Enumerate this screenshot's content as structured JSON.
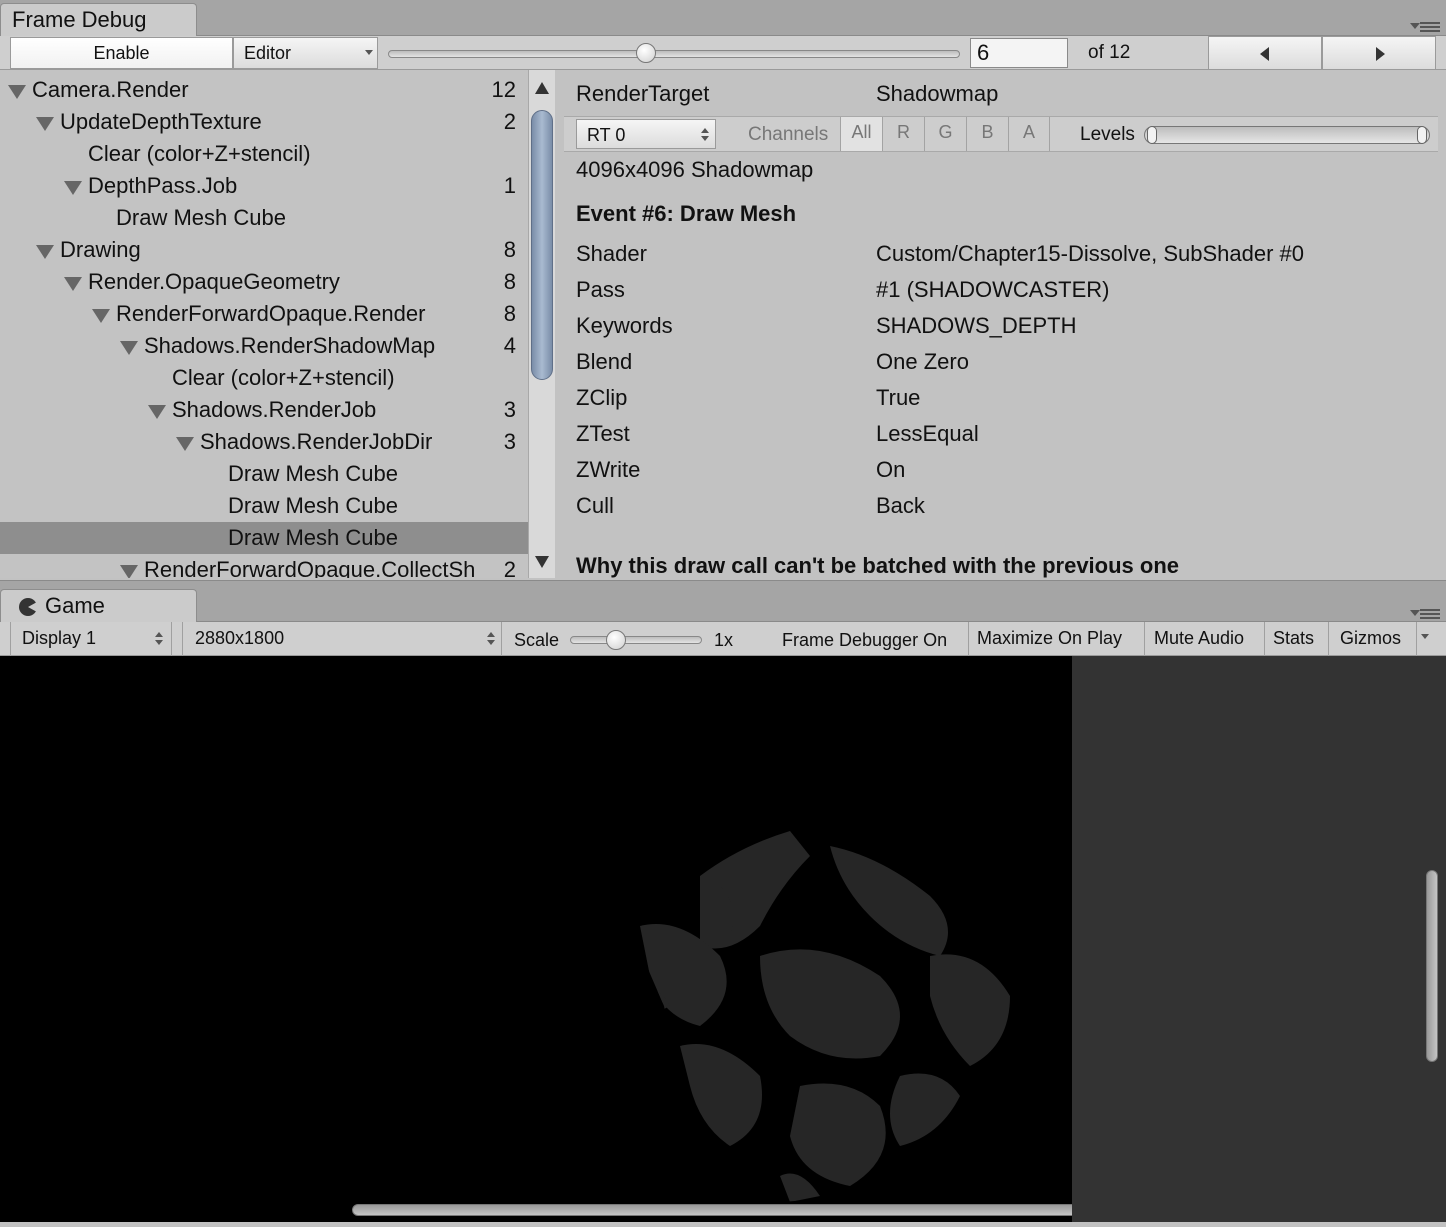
{
  "frame_debug": {
    "tab_title": "Frame Debug",
    "enable_label": "Enable",
    "editor_label": "Editor",
    "event_index": "6",
    "event_total": "of 12",
    "slider_fraction": 0.45,
    "tree": [
      {
        "label": "Camera.Render",
        "count": "12",
        "level": 0,
        "expanded": true
      },
      {
        "label": "UpdateDepthTexture",
        "count": "2",
        "level": 1,
        "expanded": true
      },
      {
        "label": "Clear (color+Z+stencil)",
        "count": "",
        "level": 2,
        "expanded": false
      },
      {
        "label": "DepthPass.Job",
        "count": "1",
        "level": 2,
        "expanded": true
      },
      {
        "label": "Draw Mesh Cube",
        "count": "",
        "level": 3,
        "expanded": false
      },
      {
        "label": "Drawing",
        "count": "8",
        "level": 1,
        "expanded": true
      },
      {
        "label": "Render.OpaqueGeometry",
        "count": "8",
        "level": 2,
        "expanded": true
      },
      {
        "label": "RenderForwardOpaque.Render",
        "count": "8",
        "level": 3,
        "expanded": true
      },
      {
        "label": "Shadows.RenderShadowMap",
        "count": "4",
        "level": 4,
        "expanded": true
      },
      {
        "label": "Clear (color+Z+stencil)",
        "count": "",
        "level": 5,
        "expanded": false
      },
      {
        "label": "Shadows.RenderJob",
        "count": "3",
        "level": 5,
        "expanded": true
      },
      {
        "label": "Shadows.RenderJobDir",
        "count": "3",
        "level": 6,
        "expanded": true
      },
      {
        "label": "Draw Mesh Cube",
        "count": "",
        "level": 7,
        "expanded": false
      },
      {
        "label": "Draw Mesh Cube",
        "count": "",
        "level": 7,
        "expanded": false
      },
      {
        "label": "Draw Mesh Cube",
        "count": "",
        "level": 7,
        "expanded": false,
        "selected": true
      },
      {
        "label": "RenderForwardOpaque.CollectSh",
        "count": "2",
        "level": 4,
        "expanded": true
      }
    ],
    "details": {
      "render_target_label": "RenderTarget",
      "render_target_value": "Shadowmap",
      "rt_select": "RT 0",
      "channels_label": "Channels",
      "channels": [
        "All",
        "R",
        "G",
        "B",
        "A"
      ],
      "levels_label": "Levels",
      "texture_info": "4096x4096 Shadowmap",
      "event_title": "Event #6: Draw Mesh",
      "properties": [
        {
          "name": "Shader",
          "value": "Custom/Chapter15-Dissolve, SubShader #0"
        },
        {
          "name": "Pass",
          "value": "#1 (SHADOWCASTER)"
        },
        {
          "name": "Keywords",
          "value": "SHADOWS_DEPTH"
        },
        {
          "name": "Blend",
          "value": "One Zero"
        },
        {
          "name": "ZClip",
          "value": "True"
        },
        {
          "name": "ZTest",
          "value": "LessEqual"
        },
        {
          "name": "ZWrite",
          "value": "On"
        },
        {
          "name": "Cull",
          "value": "Back"
        }
      ],
      "batch_note": "Why this draw call can't be batched with the previous one"
    }
  },
  "game": {
    "tab_title": "Game",
    "display": "Display 1",
    "resolution": "2880x1800",
    "scale_label": "Scale",
    "scale_value": "1x",
    "frame_debugger_on": "Frame Debugger On",
    "maximize_on_play": "Maximize On Play",
    "mute_audio": "Mute Audio",
    "stats": "Stats",
    "gizmos": "Gizmos"
  },
  "colors": {
    "selected_row": "#8e8e8e",
    "scroll_thumb": "#8fa1bb",
    "viewport_bg": "#000000",
    "viewport_side": "#333333"
  }
}
